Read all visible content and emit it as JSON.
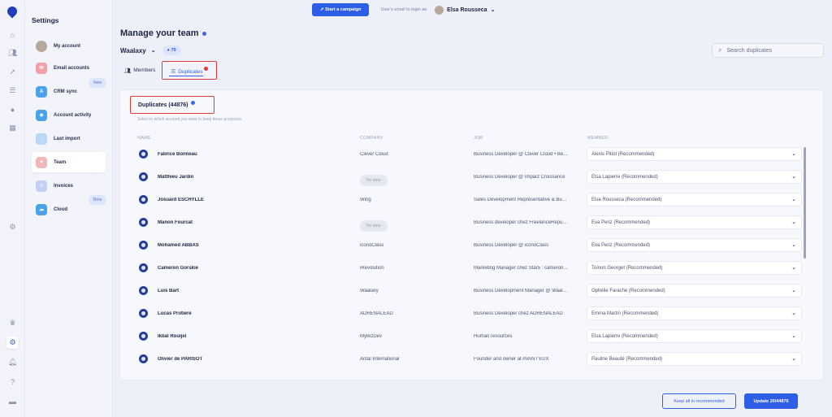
{
  "topbar": {
    "campaign_button": "Start a campaign",
    "login_text": "User's email to login as",
    "user_name": "Elsa Rousseca"
  },
  "sidebar": {
    "title": "Settings",
    "items": [
      {
        "label": "My account",
        "icon": "avatar"
      },
      {
        "label": "Email accounts",
        "icon": "email-icon",
        "color": "#f2a0a8"
      },
      {
        "label": "CRM sync",
        "icon": "crm-icon",
        "color": "#4aa3e8",
        "badge": "New"
      },
      {
        "label": "Account activity",
        "icon": "activity-icon",
        "color": "#4aa3e8"
      },
      {
        "label": "Last import",
        "icon": "import-icon",
        "color": "#b8d8f6"
      },
      {
        "label": "Team",
        "icon": "team-icon",
        "color": "#f0b8b8"
      },
      {
        "label": "Invoices",
        "icon": "invoice-icon",
        "color": "#c2d0f6"
      },
      {
        "label": "Cloud",
        "icon": "cloud-icon",
        "color": "#4aa3e8",
        "badge": "Beta"
      }
    ]
  },
  "page": {
    "title": "Manage your team",
    "workspace": "Waalaxy",
    "workspace_count": "79",
    "search_placeholder": "Search duplicates"
  },
  "tabs": {
    "members": "Members",
    "duplicates": "Duplicates"
  },
  "duplicates": {
    "heading": "Duplicates (44876)",
    "subtitle": "Select in which account you want to keep these prospects."
  },
  "columns": [
    "NAME",
    "COMPANY",
    "JOB",
    "MEMBER"
  ],
  "rows": [
    {
      "name": "Fabrice Bonneau",
      "company": "Clever Cloud",
      "job": "Business Developer @ Clever Cloud • Be…",
      "member": "Alexis Pitiot (Recommended)"
    },
    {
      "name": "Matthieu Jardin",
      "company": "No data",
      "job": "Business Developer @ Impact Croissance",
      "member": "Elsa Lapierre (Recommended)"
    },
    {
      "name": "Josuard ESCHYLLE",
      "company": "Wing",
      "job": "Sales Development Representative & Bu…",
      "member": "Elsa Rousseca (Recommended)"
    },
    {
      "name": "Manon Fourcat",
      "company": "No data",
      "job": "Business developer chez FreelanceRepu…",
      "member": "Eva Periz (Recommended)"
    },
    {
      "name": "Mohamed ABBAS",
      "company": "iconoClass",
      "job": "Business Developer @ iconoClass",
      "member": "Eva Periz (Recommended)"
    },
    {
      "name": "Cameron Gorskie",
      "company": "iRevolution",
      "job": "Marketing Manager chez Star5 : cameron…",
      "member": "Toinon Georget (Recommended)"
    },
    {
      "name": "Luis Bart",
      "company": "Waalaxy",
      "job": "Business Development Manager @ Waal…",
      "member": "Ophélie Farache (Recommended)"
    },
    {
      "name": "Lucas Protiere",
      "company": "ADRENALEAD",
      "job": "Business Developer chez ADRENALEAD",
      "member": "Emma Martín (Recommended)"
    },
    {
      "name": "Ikbal Rouijel",
      "company": "MyBizDev",
      "job": "Human resources",
      "member": "Elsa Lapierre (Recommended)"
    },
    {
      "name": "Olivier de PARISOT",
      "company": "Antal International",
      "job": "Founder and owner at AVANT'EUX",
      "member": "Pauline Beauté (Recommended)"
    }
  ],
  "footer": {
    "keep_button": "Keep all in recommended",
    "update_button": "Update 20/44876"
  }
}
